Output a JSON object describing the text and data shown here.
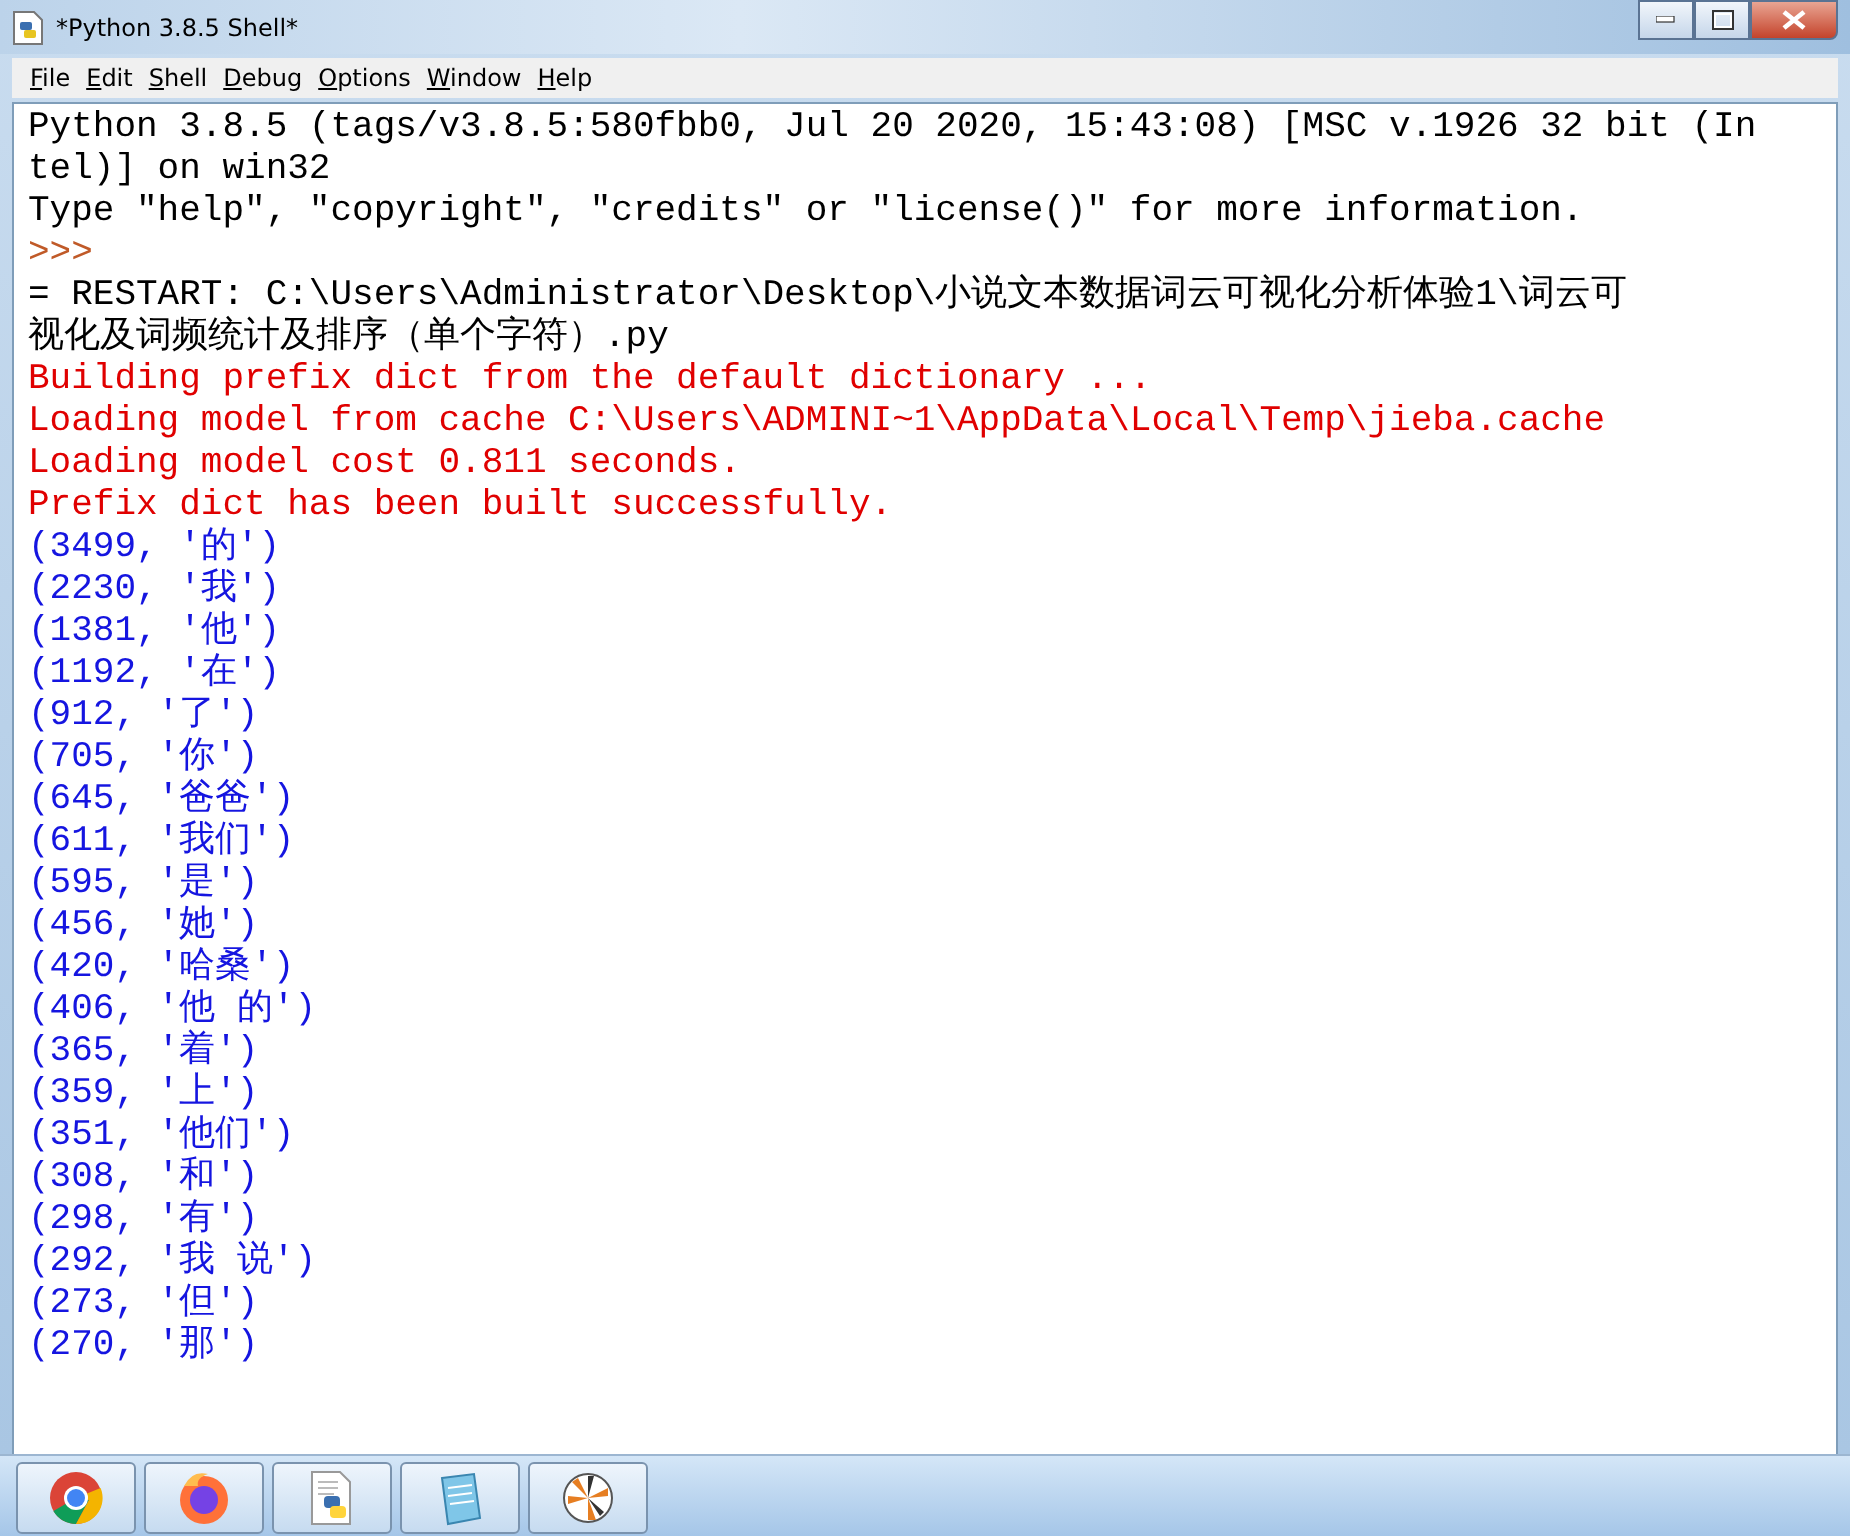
{
  "window": {
    "title": "*Python 3.8.5 Shell*"
  },
  "menu": [
    "File",
    "Edit",
    "Shell",
    "Debug",
    "Options",
    "Window",
    "Help"
  ],
  "lines": [
    {
      "kind": "stdout",
      "text": "Python 3.8.5 (tags/v3.8.5:580fbb0, Jul 20 2020, 15:43:08) [MSC v.1926 32 bit (In"
    },
    {
      "kind": "stdout",
      "text": "tel)] on win32"
    },
    {
      "kind": "stdout",
      "text": "Type \"help\", \"copyright\", \"credits\" or \"license()\" for more information."
    },
    {
      "kind": "prompt",
      "text": ">>>"
    },
    {
      "kind": "stdout",
      "text": "= RESTART: C:\\Users\\Administrator\\Desktop\\小说文本数据词云可视化分析体验1\\词云可"
    },
    {
      "kind": "stdout",
      "text": "视化及词频统计及排序（单个字符）.py"
    },
    {
      "kind": "stderr",
      "text": "Building prefix dict from the default dictionary ..."
    },
    {
      "kind": "stderr",
      "text": "Loading model from cache C:\\Users\\ADMINI~1\\AppData\\Local\\Temp\\jieba.cache"
    },
    {
      "kind": "stderr",
      "text": "Loading model cost 0.811 seconds."
    },
    {
      "kind": "stderr",
      "text": "Prefix dict has been built successfully."
    },
    {
      "kind": "result",
      "text": "(3499, '的')"
    },
    {
      "kind": "result",
      "text": "(2230, '我')"
    },
    {
      "kind": "result",
      "text": "(1381, '他')"
    },
    {
      "kind": "result",
      "text": "(1192, '在')"
    },
    {
      "kind": "result",
      "text": "(912, '了')"
    },
    {
      "kind": "result",
      "text": "(705, '你')"
    },
    {
      "kind": "result",
      "text": "(645, '爸爸')"
    },
    {
      "kind": "result",
      "text": "(611, '我们')"
    },
    {
      "kind": "result",
      "text": "(595, '是')"
    },
    {
      "kind": "result",
      "text": "(456, '她')"
    },
    {
      "kind": "result",
      "text": "(420, '哈桑')"
    },
    {
      "kind": "result",
      "text": "(406, '他 的')"
    },
    {
      "kind": "result",
      "text": "(365, '着')"
    },
    {
      "kind": "result",
      "text": "(359, '上')"
    },
    {
      "kind": "result",
      "text": "(351, '他们')"
    },
    {
      "kind": "result",
      "text": "(308, '和')"
    },
    {
      "kind": "result",
      "text": "(298, '有')"
    },
    {
      "kind": "result",
      "text": "(292, '我 说')"
    },
    {
      "kind": "result",
      "text": "(273, '但')"
    },
    {
      "kind": "result",
      "text": "(270, '那')"
    }
  ],
  "taskbar": [
    {
      "kind": "chrome"
    },
    {
      "kind": "firefox"
    },
    {
      "kind": "python"
    },
    {
      "kind": "notepad"
    },
    {
      "kind": "pinwheel"
    }
  ]
}
